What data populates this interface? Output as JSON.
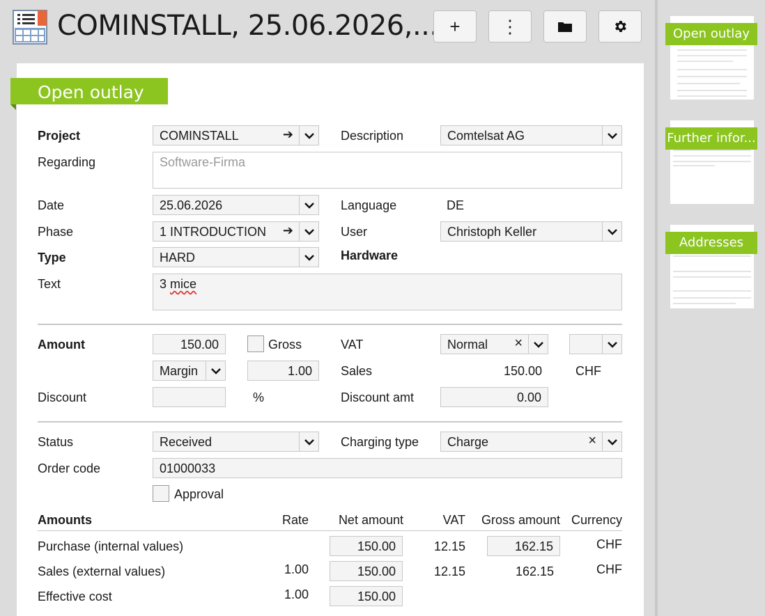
{
  "header": {
    "title": "COMINSTALL, 25.06.2026,...",
    "buttons": {
      "add": "+",
      "more": "⋮"
    }
  },
  "section_title": "Open outlay",
  "form": {
    "project": {
      "label": "Project",
      "value": "COMINSTALL"
    },
    "description": {
      "label": "Description",
      "value": "Comtelsat AG"
    },
    "regarding": {
      "label": "Regarding",
      "placeholder": "Software-Firma"
    },
    "date": {
      "label": "Date",
      "value": "25.06.2026"
    },
    "language": {
      "label": "Language",
      "value": "DE"
    },
    "phase": {
      "label": "Phase",
      "value": "1 INTRODUCTION"
    },
    "user": {
      "label": "User",
      "value": "Christoph Keller"
    },
    "type": {
      "label": "Type",
      "value": "HARD",
      "type_name": "Hardware"
    },
    "text": {
      "label": "Text",
      "value_prefix": "3 ",
      "value_word": "mice"
    },
    "amount": {
      "label": "Amount",
      "value": "150.00",
      "gross_label": "Gross"
    },
    "vat": {
      "label": "VAT",
      "value": "Normal"
    },
    "margin": {
      "value": "Margin",
      "factor": "1.00"
    },
    "sales": {
      "label": "Sales",
      "value": "150.00",
      "currency": "CHF"
    },
    "discount": {
      "label": "Discount",
      "unit": "%"
    },
    "discount_amt": {
      "label": "Discount amt",
      "value": "0.00"
    },
    "status": {
      "label": "Status",
      "value": "Received"
    },
    "charging_type": {
      "label": "Charging type",
      "value": "Charge"
    },
    "order_code": {
      "label": "Order code",
      "value": "01000033"
    },
    "approval": {
      "label": "Approval"
    }
  },
  "amounts": {
    "headers": {
      "title": "Amounts",
      "rate": "Rate",
      "net": "Net amount",
      "vat": "VAT",
      "gross": "Gross amount",
      "currency": "Currency"
    },
    "rows": [
      {
        "label": "Purchase (internal values)",
        "rate": "",
        "net": "150.00",
        "vat": "12.15",
        "gross": "162.15",
        "currency": "CHF"
      },
      {
        "label": "Sales (external values)",
        "rate": "1.00",
        "net": "150.00",
        "vat": "12.15",
        "gross": "162.15",
        "currency": "CHF"
      },
      {
        "label": "Effective cost",
        "rate": "1.00",
        "net": "150.00",
        "vat": "",
        "gross": "",
        "currency": ""
      }
    ]
  },
  "side_panels": [
    {
      "label": "Open outlay"
    },
    {
      "label": "Further infor..."
    },
    {
      "label": "Addresses"
    }
  ],
  "colors": {
    "accent": "#8cc420"
  }
}
